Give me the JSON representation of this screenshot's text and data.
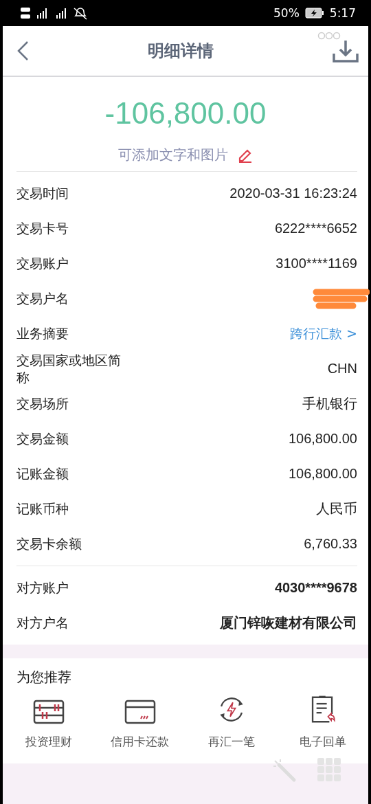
{
  "status_bar": {
    "battery": "50%",
    "time": "5:17"
  },
  "header": {
    "title": "明细详情"
  },
  "amount": "-106,800.00",
  "note_prompt": "可添加文字和图片",
  "details": [
    {
      "label": "交易时间",
      "value": "2020-03-31 16:23:24",
      "kind": "plain"
    },
    {
      "label": "交易卡号",
      "value": "6222****6652",
      "kind": "plain"
    },
    {
      "label": "交易账户",
      "value": "3100****1169",
      "kind": "plain"
    },
    {
      "label": "交易户名",
      "kind": "redacted"
    },
    {
      "label": "业务摘要",
      "value": "跨行汇款 >",
      "kind": "link"
    },
    {
      "label": "交易国家或地区简称",
      "value": "CHN",
      "kind": "plain"
    },
    {
      "label": "交易场所",
      "value": "手机银行",
      "kind": "plain"
    },
    {
      "label": "交易金额",
      "value": "106,800.00",
      "kind": "plain"
    },
    {
      "label": "记账金额",
      "value": "106,800.00",
      "kind": "plain"
    },
    {
      "label": "记账币种",
      "value": "人民币",
      "kind": "plain"
    },
    {
      "label": "交易卡余额",
      "value": "6,760.33",
      "kind": "plain"
    }
  ],
  "counterparty": [
    {
      "label": "对方账户",
      "value": "4030****9678",
      "kind": "bold"
    },
    {
      "label": "对方户名",
      "value": "厦门锌咴建材有限公司",
      "kind": "bold"
    }
  ],
  "recommend": {
    "title": "为您推荐",
    "items": [
      {
        "label": "投资理财",
        "kind": "abacus"
      },
      {
        "label": "信用卡还款",
        "kind": "card"
      },
      {
        "label": "再汇一笔",
        "kind": "repeat"
      },
      {
        "label": "电子回单",
        "kind": "receipt"
      }
    ]
  }
}
